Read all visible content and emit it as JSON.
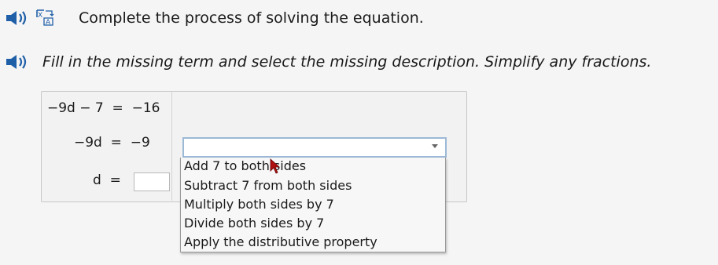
{
  "header": {
    "instruction_1": "Complete the process of solving the equation.",
    "instruction_2": "Fill in the missing term and select the missing description. Simplify any fractions."
  },
  "icons": {
    "speaker_1": "speaker-icon",
    "translate": "translate-icon",
    "speaker_2": "speaker-icon",
    "cursor": "mouse-pointer-icon"
  },
  "colors": {
    "speaker_blue": "#1f5fa8",
    "select_border": "#9cb9d6",
    "cursor_red": "#b01010"
  },
  "equations": {
    "line1": {
      "left": "−9d − 7",
      "right": "−16"
    },
    "line2": {
      "left": "−9d",
      "right": "−9"
    },
    "line3": {
      "left": "d",
      "right": ""
    }
  },
  "select": {
    "value": "",
    "options": [
      "Add 7 to both sides",
      "Subtract 7 from both sides",
      "Multiply both sides by 7",
      "Divide both sides by 7",
      "Apply the distributive property"
    ]
  }
}
